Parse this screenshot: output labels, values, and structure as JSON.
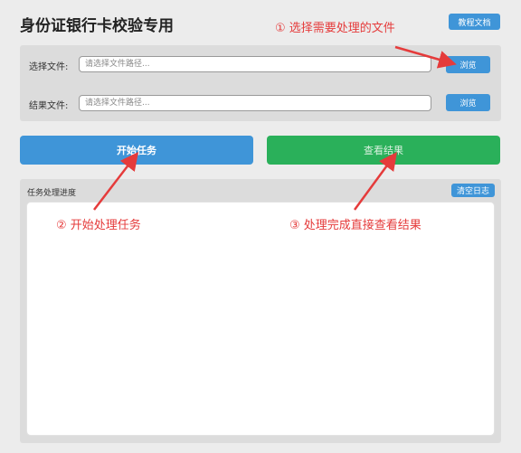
{
  "app": {
    "title": "身份证银行卡校验专用"
  },
  "header": {
    "tutorial_label": "教程文档"
  },
  "files": {
    "select_label": "选择文件:",
    "select_placeholder": "请选择文件路径...",
    "result_label": "结果文件:",
    "result_placeholder": "请选择文件路径...",
    "browse_label": "浏览"
  },
  "actions": {
    "start_label": "开始任务",
    "view_label": "查看结果"
  },
  "log": {
    "title": "任务处理进度",
    "clear_label": "清空日志"
  },
  "annotations": {
    "step1": "① 选择需要处理的文件",
    "step2": "② 开始处理任务",
    "step3": "③ 处理完成直接查看结果"
  },
  "colors": {
    "accent_blue": "#3f95d8",
    "green": "#2ab05a",
    "annotation_red": "#e53b3b"
  }
}
